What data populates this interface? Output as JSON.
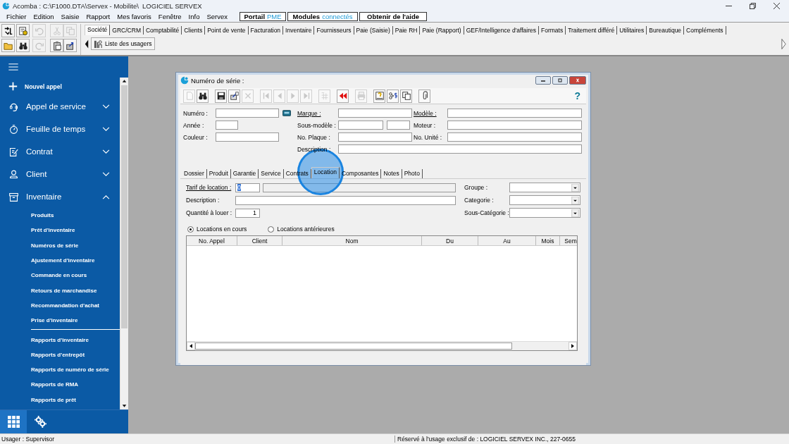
{
  "window": {
    "title": "Acomba : C:\\F1000.DTA\\Servex - Mobilite\\  LOGICIEL SERVEX"
  },
  "menu": [
    "Fichier",
    "Edition",
    "Saisie",
    "Rapport",
    "Mes favoris",
    "Fenêtre",
    "Info",
    "Servex"
  ],
  "menu_buttons": [
    {
      "label": "Portail",
      "accent": "PME"
    },
    {
      "label": "Modules",
      "accent": "connectés"
    },
    {
      "label": "Obtenir de l'aide"
    }
  ],
  "quick_tools": [
    {
      "disabled": false
    },
    {
      "disabled": false
    },
    {
      "disabled": true
    },
    {
      "disabled": true
    },
    {
      "disabled": true
    },
    {
      "disabled": false
    },
    {
      "disabled": false
    },
    {
      "disabled": true
    },
    {
      "disabled": false
    },
    {
      "disabled": false
    }
  ],
  "module_tabs": [
    {
      "label": "Société",
      "selected": true
    },
    {
      "label": "GRC/CRM",
      "selected": false
    },
    {
      "label": "Comptabilité",
      "selected": false
    },
    {
      "label": "Clients",
      "selected": false
    },
    {
      "label": "Point de vente",
      "selected": false
    },
    {
      "label": "Facturation",
      "selected": false
    },
    {
      "label": "Inventaire",
      "selected": false
    },
    {
      "label": "Fournisseurs",
      "selected": false
    },
    {
      "label": "Paie (Saisie)",
      "selected": false
    },
    {
      "label": "Paie RH",
      "selected": false
    },
    {
      "label": "Paie (Rapport)",
      "selected": false
    },
    {
      "label": "GEF/Intelligence d'affaires",
      "selected": false
    },
    {
      "label": "Formats",
      "selected": false
    },
    {
      "label": "Traitement différé",
      "selected": false
    },
    {
      "label": "Utilitaires",
      "selected": false
    },
    {
      "label": "Bureautique",
      "selected": false
    },
    {
      "label": "Compléments",
      "selected": false
    }
  ],
  "sub_toolbar": {
    "button": "Liste des usagers"
  },
  "sidebar": {
    "items": [
      {
        "kind": "action",
        "label": "Nouvel appel"
      },
      {
        "kind": "section",
        "label": "Appel de service",
        "expanded": false
      },
      {
        "kind": "section",
        "label": "Feuille de temps",
        "expanded": false
      },
      {
        "kind": "section",
        "label": "Contrat",
        "expanded": false
      },
      {
        "kind": "section",
        "label": "Client",
        "expanded": false
      },
      {
        "kind": "section",
        "label": "Inventaire",
        "expanded": true,
        "groups": [
          [
            "Produits",
            "Prêt d'inventaire",
            "Numéros de série",
            "Ajustement d'inventaire",
            "Commande en cours",
            "Retours de marchandise",
            "Recommandation d'achat",
            "Prise d'inventaire"
          ],
          [
            "Rapports d'inventaire",
            "Rapports d'entrepôt",
            "Rapports de numéro de série",
            "Rapports de RMA",
            "Rapports de prêt"
          ]
        ]
      }
    ],
    "footer_tabs": [
      {
        "selected": true
      },
      {
        "selected": false
      }
    ]
  },
  "dialog": {
    "title": "Numéro de série :",
    "tools": [
      {
        "disabled": true
      },
      {
        "disabled": false
      },
      {
        "disabled": false
      },
      {
        "disabled": false
      },
      {
        "disabled": true
      },
      {
        "disabled": true
      },
      {
        "disabled": true
      },
      {
        "disabled": true
      },
      {
        "disabled": true
      },
      {
        "disabled": true
      },
      {
        "disabled": false
      },
      {
        "disabled": true
      },
      {
        "disabled": false
      },
      {
        "disabled": false
      },
      {
        "disabled": false
      },
      {
        "disabled": false
      }
    ],
    "help": "?",
    "fields": [
      {
        "label": "Numéro :",
        "link": false,
        "kind": "lookup"
      },
      {
        "label": "Marque :",
        "link": true,
        "kind": "text"
      },
      {
        "label": "Modèle :",
        "link": true,
        "kind": "text"
      },
      {
        "label": "Année :",
        "link": false,
        "kind": "short"
      },
      {
        "label": "Sous-modèle :",
        "link": false,
        "kind": "split"
      },
      {
        "label": "Moteur :",
        "link": false,
        "kind": "text"
      },
      {
        "label": "Couleur :",
        "link": false,
        "kind": "medium"
      },
      {
        "label": "No. Plaque :",
        "link": false,
        "kind": "text"
      },
      {
        "label": "No. Unité :",
        "link": false,
        "kind": "text"
      },
      {
        "label": "Description :",
        "link": false,
        "kind": "wide"
      }
    ],
    "tabs": [
      {
        "label": "Dossier",
        "selected": false
      },
      {
        "label": "Produit",
        "selected": false
      },
      {
        "label": "Garantie",
        "selected": false
      },
      {
        "label": "Service",
        "selected": false
      },
      {
        "label": "Contrats",
        "selected": false
      },
      {
        "label": "Location",
        "selected": true
      },
      {
        "label": "Composantes",
        "selected": false
      },
      {
        "label": "Notes",
        "selected": false
      },
      {
        "label": "Photo",
        "selected": false
      }
    ],
    "location": {
      "fields": [
        {
          "label": "Tarif de location :",
          "link": true,
          "kind": "rate",
          "value": "0"
        },
        {
          "label": "Description :",
          "link": false,
          "kind": "wide"
        },
        {
          "label": "Quantité à louer :",
          "link": false,
          "kind": "number",
          "value": "1"
        }
      ],
      "selects": [
        {
          "label": "Groupe :"
        },
        {
          "label": "Categorie :"
        },
        {
          "label": "Sous-Catégorie :"
        }
      ],
      "radios": [
        {
          "label": "Locations en cours",
          "selected": true
        },
        {
          "label": "Locations antérieures",
          "selected": false
        }
      ],
      "table": {
        "columns": [
          "No. Appel",
          "Client",
          "Nom",
          "Du",
          "Au",
          "Mois",
          "Sem"
        ]
      }
    }
  },
  "status_bar": {
    "user": "Usager : Supervisor",
    "license": "Réservé à l'usage exclusif de : LOGICIEL SERVEX INC., 227-0655"
  }
}
